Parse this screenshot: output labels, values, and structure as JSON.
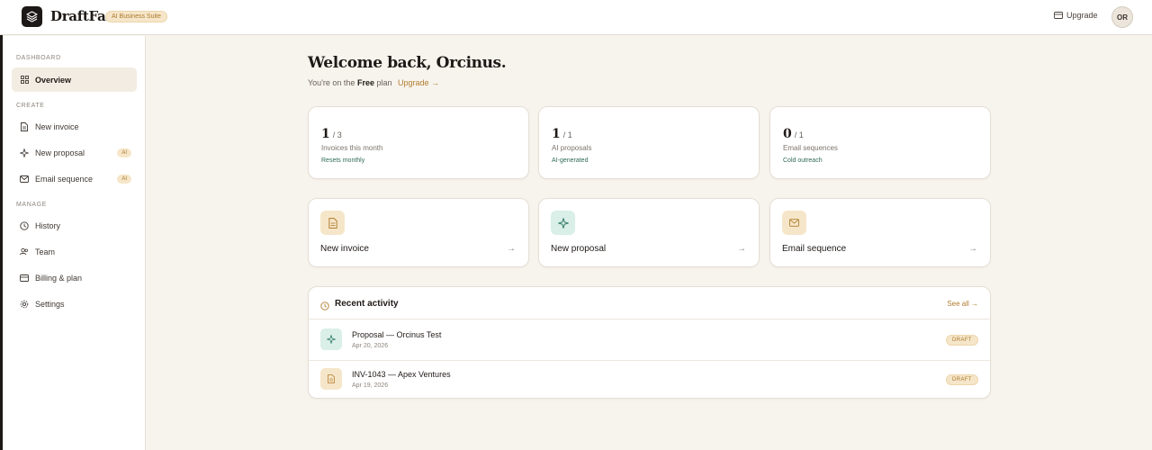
{
  "topbar": {
    "brand": "DraftFast",
    "suite_badge": "AI Business Suite",
    "upgrade_label": "Upgrade",
    "avatar_initials": "OR"
  },
  "sidebar": {
    "sections": {
      "dashboard": "DASHBOARD",
      "create": "CREATE",
      "manage": "MANAGE"
    },
    "items": [
      {
        "label": "Overview",
        "icon": "grid-icon",
        "active": true
      },
      {
        "label": "New invoice",
        "icon": "document-icon"
      },
      {
        "label": "New proposal",
        "icon": "sparkle-icon",
        "badge": "AI"
      },
      {
        "label": "Email sequence",
        "icon": "mail-icon",
        "badge": "AI"
      },
      {
        "label": "History",
        "icon": "history-icon"
      },
      {
        "label": "Team",
        "icon": "team-icon"
      },
      {
        "label": "Billing & plan",
        "icon": "card-icon"
      },
      {
        "label": "Settings",
        "icon": "gear-icon"
      }
    ]
  },
  "main": {
    "welcome": "Welcome back, Orcinus.",
    "plan_prefix": "You're on the",
    "plan_name": "Free",
    "plan_suffix": "plan",
    "plan_upgrade": "Upgrade →",
    "stats": [
      {
        "value": "1",
        "limit": "/ 3",
        "label": "Invoices this month",
        "sub": "Resets monthly"
      },
      {
        "value": "1",
        "limit": "/ 1",
        "label": "AI proposals",
        "sub": "AI-generated"
      },
      {
        "value": "0",
        "limit": "/ 1",
        "label": "Email sequences",
        "sub": "Cold outreach"
      }
    ],
    "quick_actions": [
      {
        "label": "New invoice",
        "icon": "document-icon",
        "arrow": "→"
      },
      {
        "label": "New proposal",
        "icon": "sparkle-icon",
        "arrow": "→"
      },
      {
        "label": "Email sequence",
        "icon": "mail-icon",
        "arrow": "→"
      }
    ],
    "recent": {
      "title": "Recent activity",
      "see_all": "See all →",
      "rows": [
        {
          "title": "Proposal — Orcinus Test",
          "date": "Apr 20, 2026",
          "status": "DRAFT",
          "icon": "sparkle-icon"
        },
        {
          "title": "INV-1043 — Apex Ventures",
          "date": "Apr 19, 2026",
          "status": "DRAFT",
          "icon": "document-icon"
        }
      ]
    }
  },
  "colors": {
    "accent": "#b07e2f",
    "badge_bg": "#f6e6c9",
    "teal_icon_bg": "#d9efe8",
    "amber_icon_bg": "#f6e6c9",
    "page_bg": "#f7f3ed"
  }
}
